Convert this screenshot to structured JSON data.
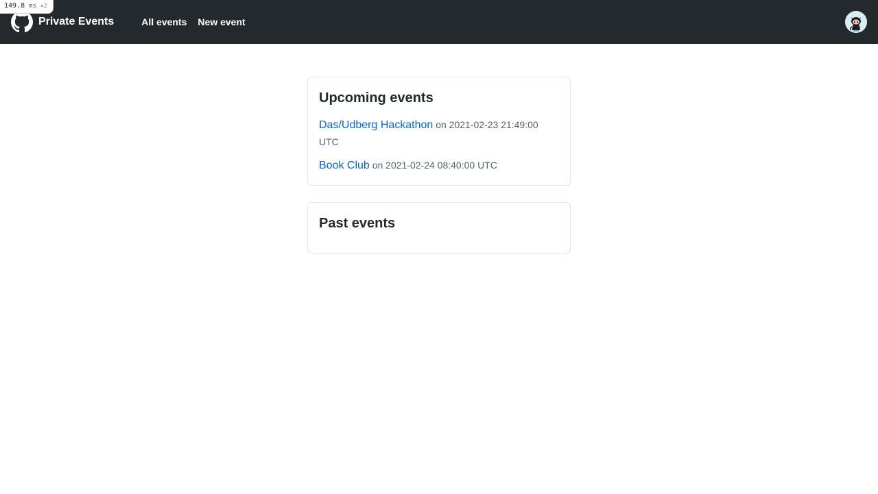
{
  "perf": {
    "value": "149.8",
    "unit": "ms",
    "multiplier": "×2"
  },
  "header": {
    "brand_name": "Private Events",
    "nav": [
      {
        "label": "All events"
      },
      {
        "label": "New event"
      }
    ],
    "avatar_icon": "octocat-avatar-icon"
  },
  "upcoming": {
    "title": "Upcoming events",
    "events": [
      {
        "name": "Das/Udberg Hackathon",
        "date_text": "on 2021-02-23 21:49:00 UTC"
      },
      {
        "name": "Book Club",
        "date_text": "on 2021-02-24 08:40:00 UTC"
      }
    ]
  },
  "past": {
    "title": "Past events",
    "events": []
  },
  "colors": {
    "header_bg": "#24292e",
    "link": "#0366d6",
    "muted_text": "#586069",
    "border": "#e1e4e8"
  }
}
